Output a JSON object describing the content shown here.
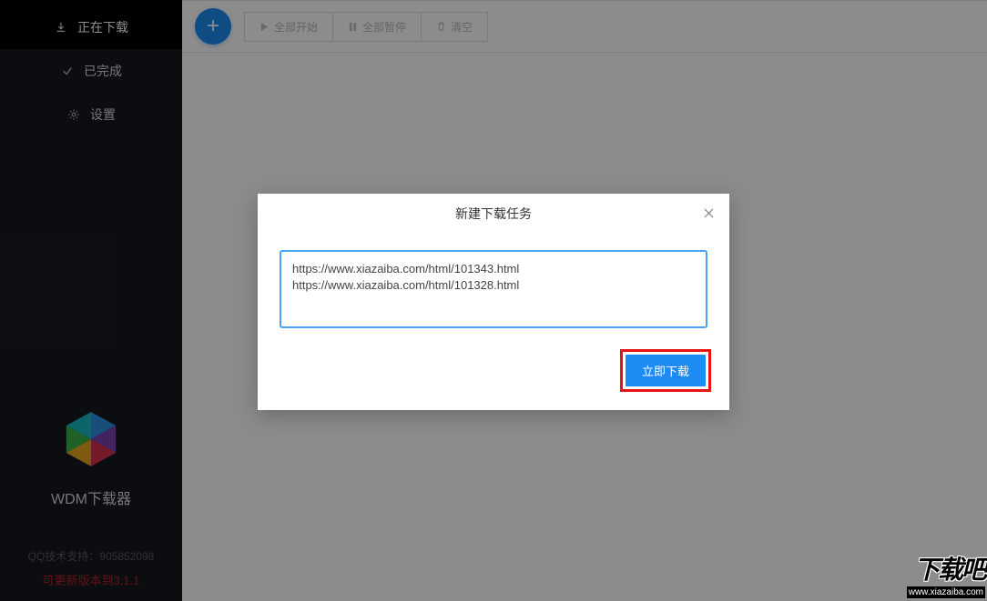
{
  "sidebar": {
    "items": [
      {
        "label": "正在下载",
        "icon": "download-icon",
        "active": true
      },
      {
        "label": "已完成",
        "icon": "check-icon",
        "active": false
      },
      {
        "label": "设置",
        "icon": "gear-icon",
        "active": false
      }
    ],
    "app_name": "WDM下载器",
    "support": "QQ技术支持：905852098",
    "version": "可更新版本到3.1.1"
  },
  "toolbar": {
    "add_label": "+",
    "start_all": "全部开始",
    "pause_all": "全部暂停",
    "clear": "清空"
  },
  "modal": {
    "title": "新建下载任务",
    "urls": "https://www.xiazaiba.com/html/101343.html\nhttps://www.xiazaiba.com/html/101328.html",
    "submit": "立即下载"
  },
  "watermark": {
    "main": "下载吧",
    "sub": "www.xiazaiba.com"
  }
}
